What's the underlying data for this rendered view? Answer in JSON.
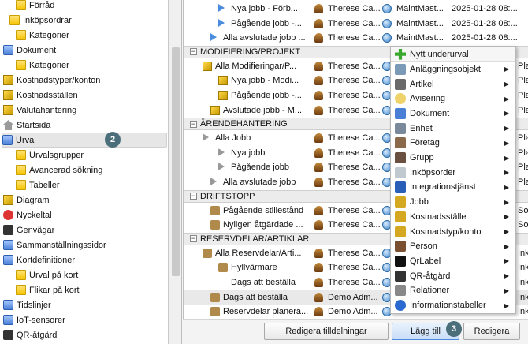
{
  "tree": {
    "items": [
      {
        "label": "Förråd",
        "icon": "folder-icon",
        "indent": 2
      },
      {
        "label": "Inköpsordrar",
        "icon": "folder-icon",
        "indent": 1
      },
      {
        "label": "Kategorier",
        "icon": "folder-icon",
        "indent": 2
      },
      {
        "label": "Dokument",
        "icon": "document-icon",
        "indent": 0
      },
      {
        "label": "Kategorier",
        "icon": "folder-icon",
        "indent": 2
      },
      {
        "label": "Kostnadstyper/konton",
        "icon": "cost-type-icon",
        "indent": 0
      },
      {
        "label": "Kostnadsställen",
        "icon": "cost-center-icon",
        "indent": 0
      },
      {
        "label": "Valutahantering",
        "icon": "currency-icon",
        "indent": 0
      },
      {
        "label": "Startsida",
        "icon": "home-icon",
        "indent": 0
      },
      {
        "label": "Urval",
        "icon": "selection-icon",
        "indent": 0,
        "selected": true
      },
      {
        "label": "Urvalsgrupper",
        "icon": "folder-icon",
        "indent": 2
      },
      {
        "label": "Avancerad sökning",
        "icon": "folder-icon",
        "indent": 2
      },
      {
        "label": "Tabeller",
        "icon": "folder-icon",
        "indent": 2
      },
      {
        "label": "Diagram",
        "icon": "diagram-icon",
        "indent": 0
      },
      {
        "label": "Nyckeltal",
        "icon": "kpi-icon",
        "indent": 0
      },
      {
        "label": "Genvägar",
        "icon": "shortcut-icon",
        "indent": 0
      },
      {
        "label": "Sammanställningssidor",
        "icon": "summary-page-icon",
        "indent": 0
      },
      {
        "label": "Kortdefinitioner",
        "icon": "card-definition-icon",
        "indent": 0
      },
      {
        "label": "Urval på kort",
        "icon": "folder-icon",
        "indent": 2
      },
      {
        "label": "Flikar på kort",
        "icon": "folder-icon",
        "indent": 2
      },
      {
        "label": "Tidslinjer",
        "icon": "timeline-icon",
        "indent": 0
      },
      {
        "label": "IoT-sensorer",
        "icon": "iot-icon",
        "indent": 0
      },
      {
        "label": "QR-åtgärd",
        "icon": "qr-action-icon",
        "indent": 0
      }
    ]
  },
  "badges": {
    "b2": "2",
    "b3": "3"
  },
  "grid": {
    "rows": [
      {
        "type": "row",
        "name": "Nya jobb - Förb...",
        "user": "Therese Ca...",
        "app": "MaintMast...",
        "date": "2025-01-28 08:...",
        "icon": "play-icon",
        "indent": 3
      },
      {
        "type": "row",
        "name": "Pågående jobb -...",
        "user": "Therese Ca...",
        "app": "MaintMast...",
        "date": "2025-01-28 08:...",
        "icon": "play-icon",
        "indent": 3
      },
      {
        "type": "row",
        "name": "Alla avslutade jobb ...",
        "user": "Therese Ca...",
        "app": "MaintMast...",
        "date": "2025-01-28 08:...",
        "icon": "play-icon",
        "indent": 2
      },
      {
        "type": "group",
        "name": "MODIFIERING/PROJEKT"
      },
      {
        "type": "row",
        "name": "Alla Modifieringar/P...",
        "user": "Therese Ca...",
        "app": "",
        "date": "",
        "icon": "cube-icon",
        "indent": 1,
        "trail": "Pla"
      },
      {
        "type": "row",
        "name": "Nya jobb - Modi...",
        "user": "Therese Ca...",
        "app": "",
        "date": "",
        "icon": "cube-icon",
        "indent": 3,
        "trail": "Pla"
      },
      {
        "type": "row",
        "name": "Pågående jobb -...",
        "user": "Therese Ca...",
        "app": "",
        "date": "",
        "icon": "cube-icon",
        "indent": 3,
        "trail": "Pla"
      },
      {
        "type": "row",
        "name": "Avslutade jobb - M...",
        "user": "Therese Ca...",
        "app": "",
        "date": "",
        "icon": "cube-icon",
        "indent": 2,
        "trail": "Pla"
      },
      {
        "type": "group",
        "name": "ÄRENDEHANTERING"
      },
      {
        "type": "row",
        "name": "Alla Jobb",
        "user": "Therese Ca...",
        "app": "",
        "date": "",
        "icon": "play-grey-icon",
        "indent": 1,
        "trail": "Pla"
      },
      {
        "type": "row",
        "name": "Nya jobb",
        "user": "Therese Ca...",
        "app": "",
        "date": "",
        "icon": "fast-forward-icon",
        "indent": 3,
        "trail": "Pla"
      },
      {
        "type": "row",
        "name": "Pågående jobb",
        "user": "Therese Ca...",
        "app": "",
        "date": "",
        "icon": "fast-forward-icon",
        "indent": 3,
        "trail": "Pla"
      },
      {
        "type": "row",
        "name": "Alla avslutade jobb",
        "user": "Therese Ca...",
        "app": "",
        "date": "",
        "icon": "play-grey-icon",
        "indent": 2,
        "trail": "Pla"
      },
      {
        "type": "group",
        "name": "DRIFTSTOPP"
      },
      {
        "type": "row",
        "name": "Pågående stillestånd",
        "user": "Therese Ca...",
        "app": "",
        "date": "",
        "icon": "downtime-icon",
        "indent": 2,
        "trail": "So"
      },
      {
        "type": "row",
        "name": "Nyligen åtgärdade ...",
        "user": "Therese Ca...",
        "app": "",
        "date": "",
        "icon": "downtime-fixed-icon",
        "indent": 2,
        "trail": "So"
      },
      {
        "type": "group",
        "name": "RESERVDELAR/ARTIKLAR"
      },
      {
        "type": "row",
        "name": "Alla Reservdelar/Arti...",
        "user": "Therese Ca...",
        "app": "",
        "date": "",
        "icon": "spare-part-icon",
        "indent": 1,
        "trail": "Ink"
      },
      {
        "type": "row",
        "name": "Hyllvärmare",
        "user": "Therese Ca...",
        "app": "",
        "date": "",
        "icon": "dollar-icon",
        "indent": 3,
        "trail": "Ink"
      },
      {
        "type": "row",
        "name": "Dags att beställa",
        "user": "Therese Ca...",
        "app": "",
        "date": "",
        "icon": "",
        "indent": 3,
        "trail": "Ink"
      },
      {
        "type": "row",
        "name": "Dags att beställa",
        "user": "Demo Adm...",
        "app": "",
        "date": "",
        "icon": "order-icon",
        "indent": 2,
        "trail": "Ink",
        "highlight": true
      },
      {
        "type": "row",
        "name": "Reservdelar planera...",
        "user": "Demo Adm...",
        "app": "",
        "date": "",
        "icon": "plan-icon",
        "indent": 2,
        "trail": "Ink"
      }
    ]
  },
  "menu": {
    "items": [
      {
        "label": "Nytt underurval",
        "icon": "plus-icon",
        "submenu": false
      },
      {
        "label": "Anläggningsobjekt",
        "icon": "gear-icon",
        "submenu": true
      },
      {
        "label": "Artikel",
        "icon": "article-icon",
        "submenu": true
      },
      {
        "label": "Avisering",
        "icon": "notification-icon",
        "submenu": true
      },
      {
        "label": "Dokument",
        "icon": "document-icon",
        "submenu": true
      },
      {
        "label": "Enhet",
        "icon": "unit-icon",
        "submenu": true
      },
      {
        "label": "Företag",
        "icon": "company-icon",
        "submenu": true
      },
      {
        "label": "Grupp",
        "icon": "group-icon",
        "submenu": true
      },
      {
        "label": "Inköpsorder",
        "icon": "purchase-order-icon",
        "submenu": true
      },
      {
        "label": "Integrationstjänst",
        "icon": "integration-icon",
        "submenu": true
      },
      {
        "label": "Jobb",
        "icon": "job-icon",
        "submenu": true
      },
      {
        "label": "Kostnadsställe",
        "icon": "cost-center-icon",
        "submenu": true
      },
      {
        "label": "Kostnadstyp/konto",
        "icon": "cost-type-icon",
        "submenu": true
      },
      {
        "label": "Person",
        "icon": "person-icon",
        "submenu": true
      },
      {
        "label": "QrLabel",
        "icon": "qr-label-icon",
        "submenu": true
      },
      {
        "label": "QR-åtgärd",
        "icon": "qr-action-icon",
        "submenu": true
      },
      {
        "label": "Relationer",
        "icon": "relations-icon",
        "submenu": true
      },
      {
        "label": "Informationstabeller",
        "icon": "info-icon",
        "submenu": true
      }
    ]
  },
  "buttons": {
    "edit_assignments": "Redigera tilldelningar",
    "add": "Lägg till",
    "edit": "Redigera"
  }
}
